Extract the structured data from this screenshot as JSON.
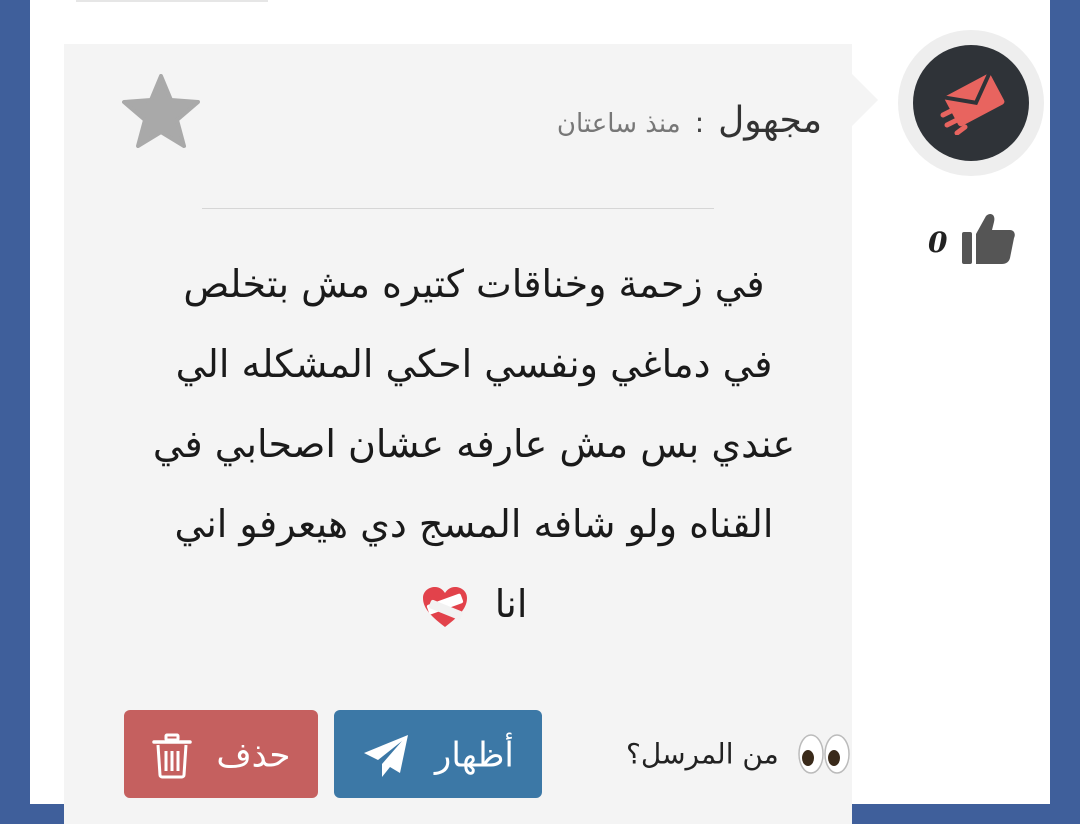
{
  "message_card": {
    "sender_name": "مجهول",
    "separator": ":",
    "time_ago": "منذ ساعتان",
    "body_lines": [
      "في زحمة وخناقات كتيره مش بتخلص",
      "في دماغي ونفسي احكي المشكله الي",
      "عندي بس مش عارفه عشان اصحابي في",
      "القناه ولو شافه المسج دي هيعرفو اني"
    ],
    "body_last_line": "انا",
    "like_count": "0",
    "reveal_prompt": "من المرسل؟",
    "show_button_label": "أظهار",
    "delete_button_label": "حذف"
  },
  "colors": {
    "page_background": "#3f5f9b",
    "card_background": "#f4f4f4",
    "avatar_background": "#2f3338",
    "avatar_icon": "#e8645f",
    "show_button": "#3c78a6",
    "delete_button": "#c5605f"
  },
  "icons": {
    "avatar": "envelope-paper-plane-icon",
    "favorite": "star-icon",
    "like": "thumbs-up-icon",
    "emoji": "mending-heart-emoji",
    "reveal": "eyes-emoji",
    "show": "paper-plane-icon",
    "delete": "trash-icon"
  }
}
